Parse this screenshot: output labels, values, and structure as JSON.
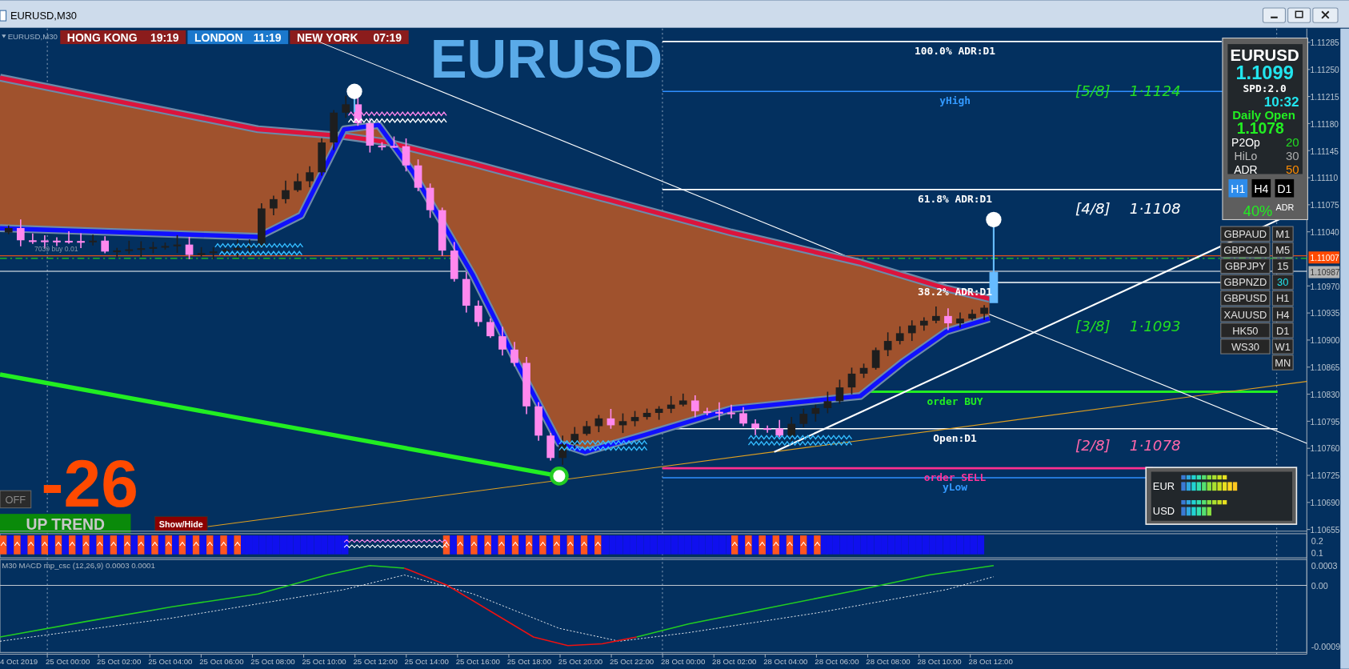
{
  "window": {
    "title": "EURUSD,M30"
  },
  "chart": {
    "label": "EURUSD,M30",
    "symbol_title": "EURUSD",
    "order_label": "7039 buy 0.01",
    "sessions": [
      {
        "city": "HONG KONG",
        "time": "19:19",
        "color": "#8b1c1c"
      },
      {
        "city": "LONDON",
        "time": "11:19",
        "color": "#1b78cc"
      },
      {
        "city": "NEW YORK",
        "time": "07:19",
        "color": "#8b1c1c"
      }
    ],
    "levels": [
      {
        "kind": "adr",
        "label": "100.0% ADR:D1"
      },
      {
        "kind": "yhigh",
        "label": "yHigh"
      },
      {
        "kind": "adr",
        "label": "61.8% ADR:D1"
      },
      {
        "kind": "adr",
        "label": "38.2% ADR:D1"
      },
      {
        "kind": "buy",
        "label": "order BUY"
      },
      {
        "kind": "open",
        "label": "Open:D1"
      },
      {
        "kind": "sell",
        "label": "order SELL"
      },
      {
        "kind": "ylow",
        "label": "yLow"
      }
    ],
    "murrey": [
      {
        "label": "[5/8]",
        "price": "1·1124",
        "color": "#22dd22"
      },
      {
        "label": "[4/8]",
        "price": "1·1108",
        "color": "#ffffff"
      },
      {
        "label": "[3/8]",
        "price": "1·1093",
        "color": "#22dd22"
      },
      {
        "label": "[2/8]",
        "price": "1·1078",
        "color": "#ff66aa"
      }
    ],
    "counter": "-26",
    "off_button": "OFF",
    "trend": "UP TREND",
    "show_hide": "Show/Hide",
    "price_axis": {
      "ticks": [
        "1.11285",
        "1.11250",
        "1.11215",
        "1.11180",
        "1.11145",
        "1.11110",
        "1.11075",
        "1.11040",
        "1.10970",
        "1.10935",
        "1.10900",
        "1.10865",
        "1.10830",
        "1.10795",
        "1.10760",
        "1.10725",
        "1.10690",
        "1.10655"
      ],
      "tags": [
        {
          "kind": "bid",
          "value": "1.11007"
        },
        {
          "kind": "line",
          "value": "1.10987"
        }
      ]
    },
    "time_axis": [
      "4 Oct 2019",
      "25 Oct 00:00",
      "25 Oct 02:00",
      "25 Oct 04:00",
      "25 Oct 06:00",
      "25 Oct 08:00",
      "25 Oct 10:00",
      "25 Oct 12:00",
      "25 Oct 14:00",
      "25 Oct 16:00",
      "25 Oct 18:00",
      "25 Oct 20:00",
      "25 Oct 22:00",
      "28 Oct 00:00",
      "28 Oct 02:00",
      "28 Oct 04:00",
      "28 Oct 06:00",
      "28 Oct 08:00",
      "28 Oct 10:00",
      "28 Oct 12:00"
    ]
  },
  "info_panel": {
    "symbol": "EURUSD",
    "bid": "1.1099",
    "spread": "SPD:2.0",
    "timer": "10:32",
    "daily_open_label": "Daily Open",
    "daily_open": "1.1078",
    "stats": [
      {
        "label": "P2Op",
        "value": "20",
        "color": "#22dd22"
      },
      {
        "label": "HiLo",
        "value": "30",
        "color": "#aaaaaa"
      },
      {
        "label": "ADR",
        "value": "50",
        "color": "#ff8c00"
      }
    ],
    "periods": [
      {
        "label": "H1",
        "selected": true
      },
      {
        "label": "H4",
        "selected": false
      },
      {
        "label": "D1",
        "selected": false
      }
    ],
    "adr_percent": "40%",
    "adr_label": "ADR"
  },
  "symbols": [
    "GBPAUD",
    "GBPCAD",
    "GBPJPY",
    "GBPNZD",
    "GBPUSD",
    "XAUUSD",
    "HK50",
    "WS30"
  ],
  "timeframes": [
    {
      "label": "M1",
      "selected": false
    },
    {
      "label": "M5",
      "selected": false
    },
    {
      "label": "15",
      "selected": false
    },
    {
      "label": "30",
      "selected": true
    },
    {
      "label": "H1",
      "selected": false
    },
    {
      "label": "H4",
      "selected": false
    },
    {
      "label": "D1",
      "selected": false
    },
    {
      "label": "W1",
      "selected": false
    },
    {
      "label": "MN",
      "selected": false
    }
  ],
  "strength_panel": [
    {
      "currency": "EUR"
    },
    {
      "currency": "USD"
    }
  ],
  "signal_window": {
    "ticks": [
      "0.2",
      "0.1"
    ]
  },
  "macd": {
    "label": "M30 MACD mp_csc (12,26,9) 0.0003 0.0001",
    "ticks": [
      "0.0003",
      "0.00",
      "-0.0009"
    ]
  }
}
